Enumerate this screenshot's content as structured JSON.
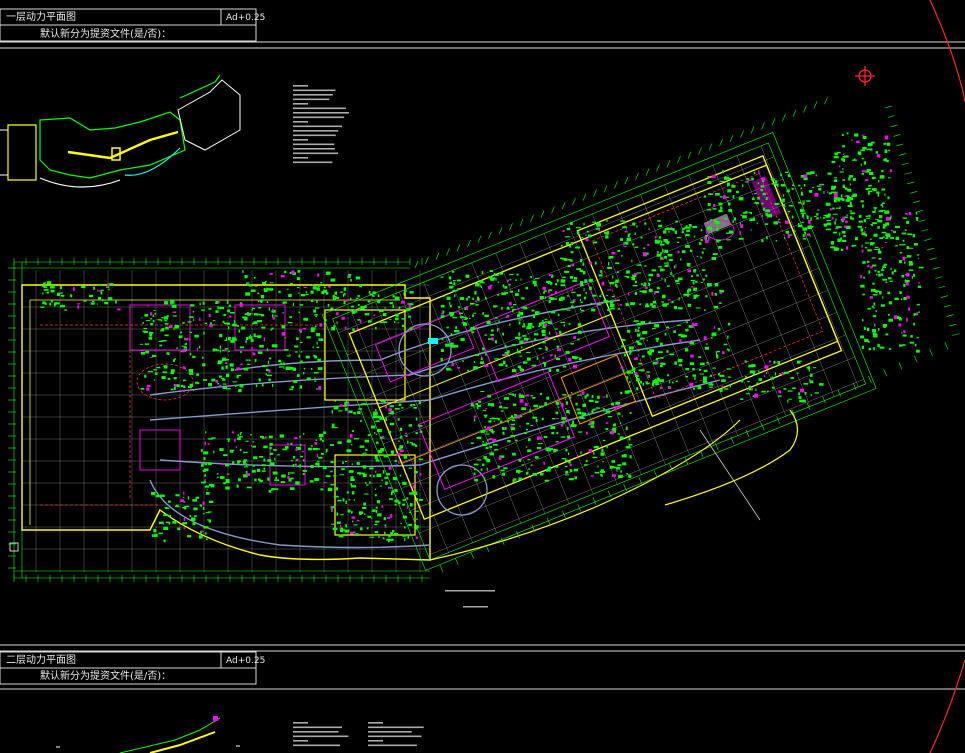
{
  "drawing": {
    "sheet1": {
      "title": "一层动力平面图",
      "scale": "Ad+0.25",
      "subtitle": "默认新分为提资文件(是/否)："
    },
    "sheet2": {
      "title": "二层动力平面图",
      "scale": "Ad+0.25",
      "subtitle": "默认新分为提资文件(是/否)："
    }
  },
  "colors": {
    "background": "#000000",
    "frame": "#e8e8e8",
    "grid": "#00ff00",
    "walls": "#ffff00",
    "equipment": "#ff00ff",
    "routes": "#8899cc",
    "columns": "#ff3333",
    "glass": "#00ffff"
  },
  "icons": {
    "north_arrow": "crosshair-circle-icon"
  }
}
